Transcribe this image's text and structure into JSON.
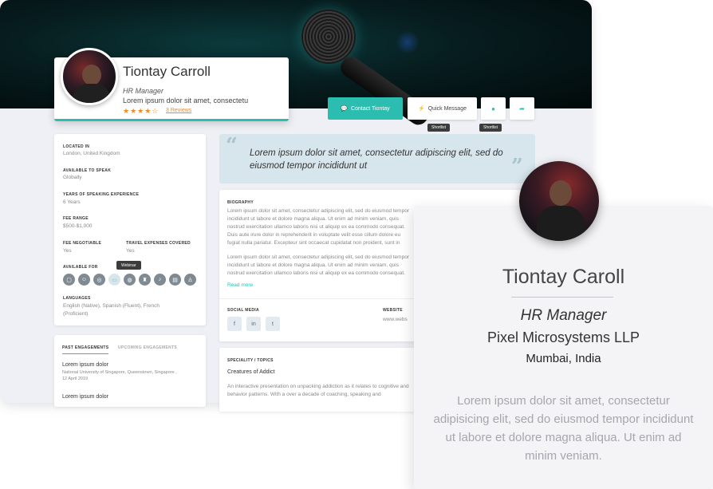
{
  "profile": {
    "name": "Tiontay Carroll",
    "role": "HR Manager",
    "tagline": "Lorem ipsum dolor sit amet, consectetu",
    "stars": "★★★★☆",
    "rating": 4,
    "reviews": "3 Reviews"
  },
  "actions": {
    "contact_label": "Contact Tiontay",
    "quick_message_label": "Quick Message",
    "shortlist_tip_1": "Shortlist",
    "shortlist_tip_2": "Shortlist"
  },
  "details": {
    "located_in_label": "LOCATED IN",
    "located_in_value": "London, United Kingdom",
    "available_to_speak_label": "AVAILABLE TO SPEAK",
    "available_to_speak_value": "Globally",
    "experience_label": "YEARS OF SPEAKING EXPERIENCE",
    "experience_value": "6 Years",
    "fee_range_label": "FEE RANGE",
    "fee_range_value": "$500-$1,000",
    "fee_negotiable_label": "FEE NEGOTIABLE",
    "fee_negotiable_value": "Yes",
    "travel_label": "TRAVEL EXPENSES COVERED",
    "travel_value": "Yes",
    "available_for_label": "AVAILABLE FOR",
    "webinar_tip": "Webinar",
    "languages_label": "LANGUAGES",
    "languages_value_1": "English (Native), Spanish (Fluent), French",
    "languages_value_2": "(Proficient)"
  },
  "engagements": {
    "tab_past": "PAST ENGAGEMENTS",
    "tab_upcoming": "UPCOMING ENGAGEMENTS",
    "item1_title": "Lorem ipsum dolor",
    "item1_meta": "National University of Singapore, Queenstown, Singapore ,",
    "item1_date": "12 April 2019",
    "item2_title": "Lorem ipsum dolor"
  },
  "quote": "Lorem ipsum dolor sit amet, consectetur adipiscing elit, sed do eiusmod tempor incididunt ut",
  "biography": {
    "label": "BIOGRAPHY",
    "para1": "Lorem ipsum dolor sit amet, consectetur adipiscing elit, sed do eiusmod tempor incididunt ut labore et dolore magna aliqua. Ut enim ad minim veniam, quis nostrud exercitation ullamco laboris nisi ut aliquip ex ea commodo consequat. Duis aute irure dolor in reprehenderit in voluptate velit esse cillum dolore eu fugiat nulla pariatur. Excepteur sint occaecat cupidatat non proident, sunt in culpa qui officia deserunt mollit anim id est laborum.",
    "para2": "Lorem ipsum dolor sit amet, consectetur adipiscing elit, sed do eiusmod tempor incididunt ut labore et dolore magna aliqua. Ut enim ad minim veniam, quis nostrud exercitation ullamco laboris nisi ut aliquip ex ea commodo consequat. Duis aute irure dolor in reprehenderit in voluptate velit esse cillum dolore eu fugiat nulla.",
    "read_more": "Read more",
    "social_label": "SOCIAL MEDIA",
    "website_label": "WEBSITE",
    "website_value": "www.webs"
  },
  "specialty": {
    "label": "SPECIALITY / TOPICS",
    "title": "Creatures of Addict",
    "desc": "An interactive presentation on unpacking addiction as it relates to cognitive and behavior patterns. With a over a decade of coaching, speaking and"
  },
  "speaker_card": {
    "name": "Tiontay Caroll",
    "role": "HR Manager",
    "company": "Pixel Microsystems LLP",
    "location": "Mumbai, India",
    "description": "Lorem ipsum dolor sit amet, consectetur adipisicing elit, sed do eiusmod tempor incididunt ut labore et dolore magna aliqua. Ut enim ad minim veniam."
  },
  "colors": {
    "accent": "#2bbdb0",
    "star": "#f08a24",
    "quote_bg": "#d6e6ec"
  }
}
